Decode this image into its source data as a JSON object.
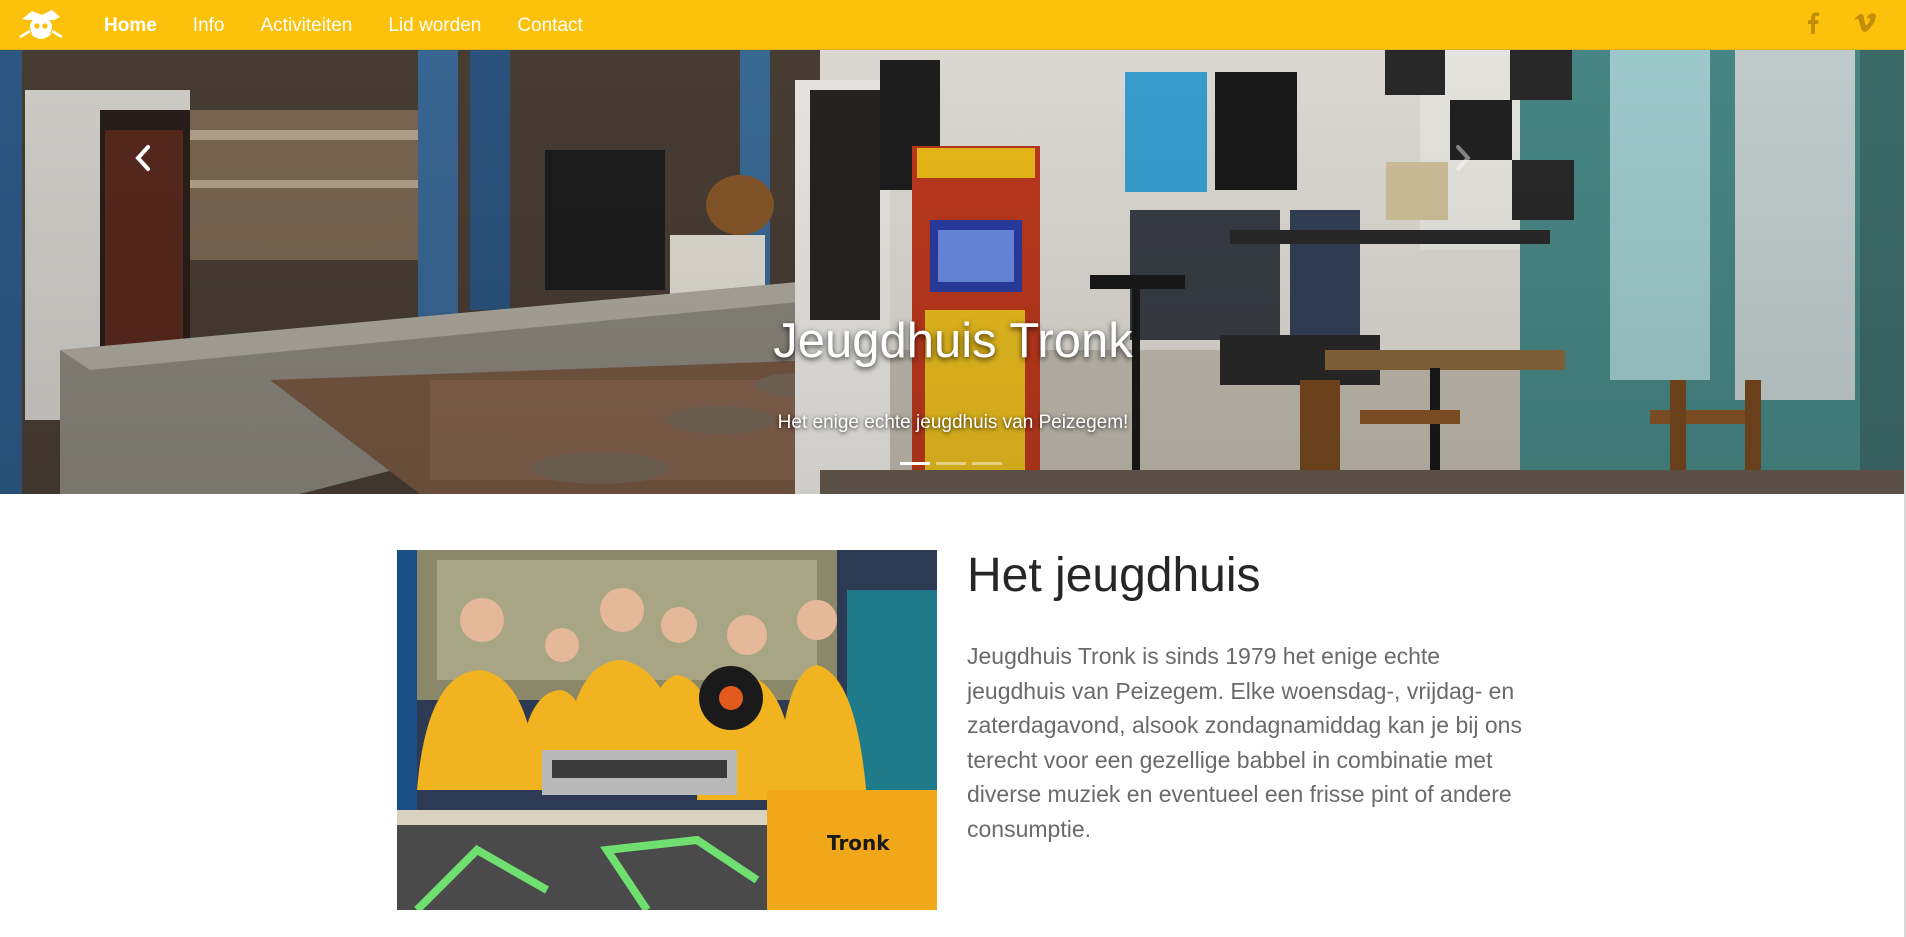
{
  "nav": {
    "logo_icon": "pirate-skull-logo",
    "items": [
      {
        "label": "Home",
        "active": true
      },
      {
        "label": "Info",
        "active": false
      },
      {
        "label": "Activiteiten",
        "active": false
      },
      {
        "label": "Lid worden",
        "active": false
      },
      {
        "label": "Contact",
        "active": false
      }
    ],
    "social": [
      "facebook-icon",
      "vimeo-icon"
    ]
  },
  "hero": {
    "title": "Jeugdhuis Tronk",
    "subtitle": "Het enige echte jeugdhuis van Peizegem!",
    "slides_total": 3,
    "active_slide": 1
  },
  "about": {
    "title": "Het jeugdhuis",
    "body": "Jeugdhuis Tronk is sinds 1979 het enige echte jeugdhuis van Peizegem. Elke woensdag-, vrijdag- en zaterdagavond, alsook zondagnamiddag kan je bij ons terecht voor een gezellige babbel in combinatie met diverse muziek en eventueel een frisse pint of andere consumptie."
  },
  "colors": {
    "brand_yellow": "#fcc20b",
    "text_dark": "#262626",
    "text_body": "#6a6a6a"
  }
}
